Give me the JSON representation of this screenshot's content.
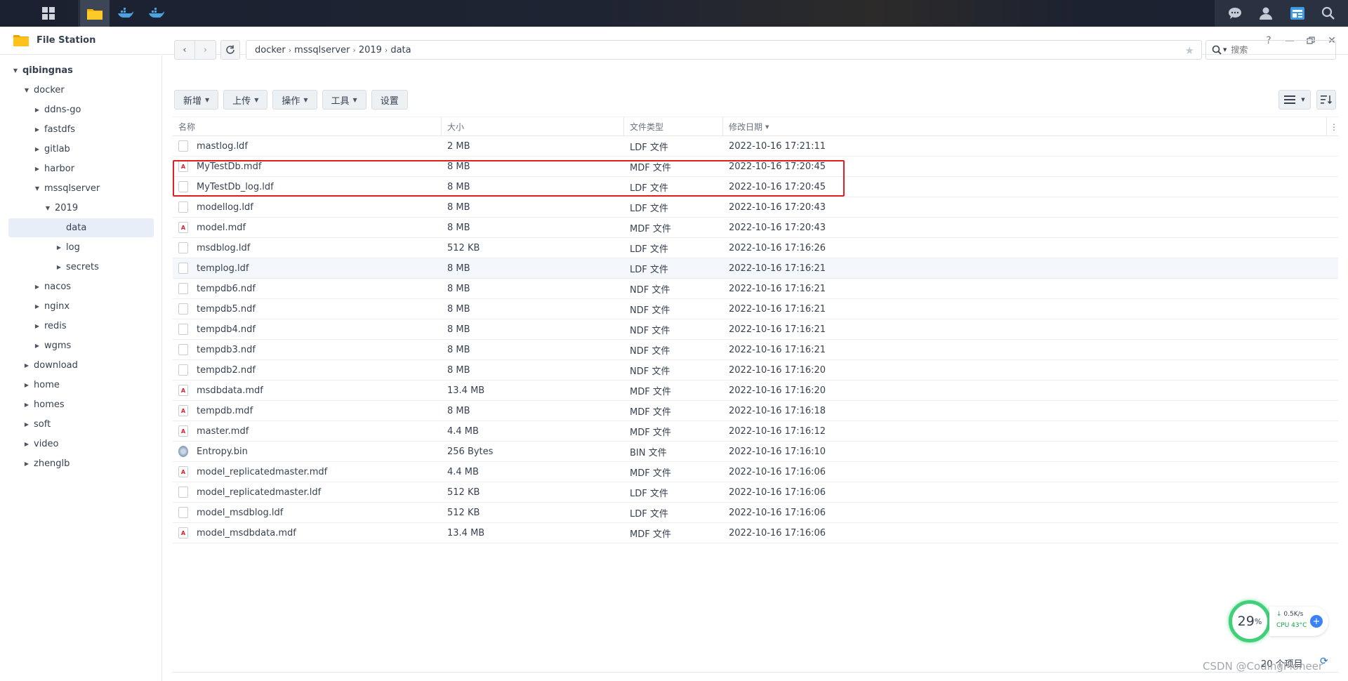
{
  "window": {
    "title": "File Station"
  },
  "sidebar": {
    "items": [
      {
        "label": "qibingnas",
        "depth": 0,
        "caret": "down"
      },
      {
        "label": "docker",
        "depth": 1,
        "caret": "down"
      },
      {
        "label": "ddns-go",
        "depth": 2,
        "caret": "right"
      },
      {
        "label": "fastdfs",
        "depth": 2,
        "caret": "right"
      },
      {
        "label": "gitlab",
        "depth": 2,
        "caret": "right"
      },
      {
        "label": "harbor",
        "depth": 2,
        "caret": "right"
      },
      {
        "label": "mssqlserver",
        "depth": 2,
        "caret": "down"
      },
      {
        "label": "2019",
        "depth": 3,
        "caret": "down"
      },
      {
        "label": "data",
        "depth": 4,
        "caret": "none",
        "selected": true
      },
      {
        "label": "log",
        "depth": 4,
        "caret": "right"
      },
      {
        "label": "secrets",
        "depth": 4,
        "caret": "right"
      },
      {
        "label": "nacos",
        "depth": 2,
        "caret": "right"
      },
      {
        "label": "nginx",
        "depth": 2,
        "caret": "right"
      },
      {
        "label": "redis",
        "depth": 2,
        "caret": "right"
      },
      {
        "label": "wgms",
        "depth": 2,
        "caret": "right"
      },
      {
        "label": "download",
        "depth": 1,
        "caret": "right"
      },
      {
        "label": "home",
        "depth": 1,
        "caret": "right"
      },
      {
        "label": "homes",
        "depth": 1,
        "caret": "right"
      },
      {
        "label": "soft",
        "depth": 1,
        "caret": "right"
      },
      {
        "label": "video",
        "depth": 1,
        "caret": "right"
      },
      {
        "label": "zhenglb",
        "depth": 1,
        "caret": "right"
      }
    ]
  },
  "path": {
    "segments": [
      "docker",
      "mssqlserver",
      "2019",
      "data"
    ]
  },
  "search": {
    "placeholder": "搜索"
  },
  "toolbar": {
    "new_label": "新增",
    "upload_label": "上传",
    "action_label": "操作",
    "tools_label": "工具",
    "settings_label": "设置"
  },
  "table": {
    "columns": [
      "名称",
      "大小",
      "文件类型",
      "修改日期"
    ],
    "rows": [
      {
        "name": "mastlog.ldf",
        "size": "2 MB",
        "type": "LDF 文件",
        "date": "2022-10-16 17:21:11",
        "icon": "blank-file-icon"
      },
      {
        "name": "MyTestDb.mdf",
        "size": "8 MB",
        "type": "MDF 文件",
        "date": "2022-10-16 17:20:45",
        "icon": "mdf-file-icon"
      },
      {
        "name": "MyTestDb_log.ldf",
        "size": "8 MB",
        "type": "LDF 文件",
        "date": "2022-10-16 17:20:45",
        "icon": "blank-file-icon"
      },
      {
        "name": "modellog.ldf",
        "size": "8 MB",
        "type": "LDF 文件",
        "date": "2022-10-16 17:20:43",
        "icon": "blank-file-icon"
      },
      {
        "name": "model.mdf",
        "size": "8 MB",
        "type": "MDF 文件",
        "date": "2022-10-16 17:20:43",
        "icon": "mdf-file-icon"
      },
      {
        "name": "msdblog.ldf",
        "size": "512 KB",
        "type": "LDF 文件",
        "date": "2022-10-16 17:16:26",
        "icon": "blank-file-icon"
      },
      {
        "name": "templog.ldf",
        "size": "8 MB",
        "type": "LDF 文件",
        "date": "2022-10-16 17:16:21",
        "icon": "blank-file-icon",
        "hover": true
      },
      {
        "name": "tempdb6.ndf",
        "size": "8 MB",
        "type": "NDF 文件",
        "date": "2022-10-16 17:16:21",
        "icon": "blank-file-icon"
      },
      {
        "name": "tempdb5.ndf",
        "size": "8 MB",
        "type": "NDF 文件",
        "date": "2022-10-16 17:16:21",
        "icon": "blank-file-icon"
      },
      {
        "name": "tempdb4.ndf",
        "size": "8 MB",
        "type": "NDF 文件",
        "date": "2022-10-16 17:16:21",
        "icon": "blank-file-icon"
      },
      {
        "name": "tempdb3.ndf",
        "size": "8 MB",
        "type": "NDF 文件",
        "date": "2022-10-16 17:16:21",
        "icon": "blank-file-icon"
      },
      {
        "name": "tempdb2.ndf",
        "size": "8 MB",
        "type": "NDF 文件",
        "date": "2022-10-16 17:16:20",
        "icon": "blank-file-icon"
      },
      {
        "name": "msdbdata.mdf",
        "size": "13.4 MB",
        "type": "MDF 文件",
        "date": "2022-10-16 17:16:20",
        "icon": "mdf-file-icon"
      },
      {
        "name": "tempdb.mdf",
        "size": "8 MB",
        "type": "MDF 文件",
        "date": "2022-10-16 17:16:18",
        "icon": "mdf-file-icon"
      },
      {
        "name": "master.mdf",
        "size": "4.4 MB",
        "type": "MDF 文件",
        "date": "2022-10-16 17:16:12",
        "icon": "mdf-file-icon"
      },
      {
        "name": "Entropy.bin",
        "size": "256 Bytes",
        "type": "BIN 文件",
        "date": "2022-10-16 17:16:10",
        "icon": "bin-file-icon"
      },
      {
        "name": "model_replicatedmaster.mdf",
        "size": "4.4 MB",
        "type": "MDF 文件",
        "date": "2022-10-16 17:16:06",
        "icon": "mdf-file-icon"
      },
      {
        "name": "model_replicatedmaster.ldf",
        "size": "512 KB",
        "type": "LDF 文件",
        "date": "2022-10-16 17:16:06",
        "icon": "blank-file-icon"
      },
      {
        "name": "model_msdblog.ldf",
        "size": "512 KB",
        "type": "LDF 文件",
        "date": "2022-10-16 17:16:06",
        "icon": "blank-file-icon"
      },
      {
        "name": "model_msdbdata.mdf",
        "size": "13.4 MB",
        "type": "MDF 文件",
        "date": "2022-10-16 17:16:06",
        "icon": "mdf-file-icon"
      }
    ]
  },
  "status": {
    "item_count": "20 个项目"
  },
  "widget": {
    "cpu_percent": "29",
    "percent_sign": "%",
    "net_speed": "0.5K/s",
    "cpu_label": "CPU 43°C"
  },
  "watermark": "CSDN @CodingPioneer",
  "colors": {
    "highlight": "#e02020",
    "accent": "#1f6fd1",
    "cpu_ring": "#41d07a"
  }
}
